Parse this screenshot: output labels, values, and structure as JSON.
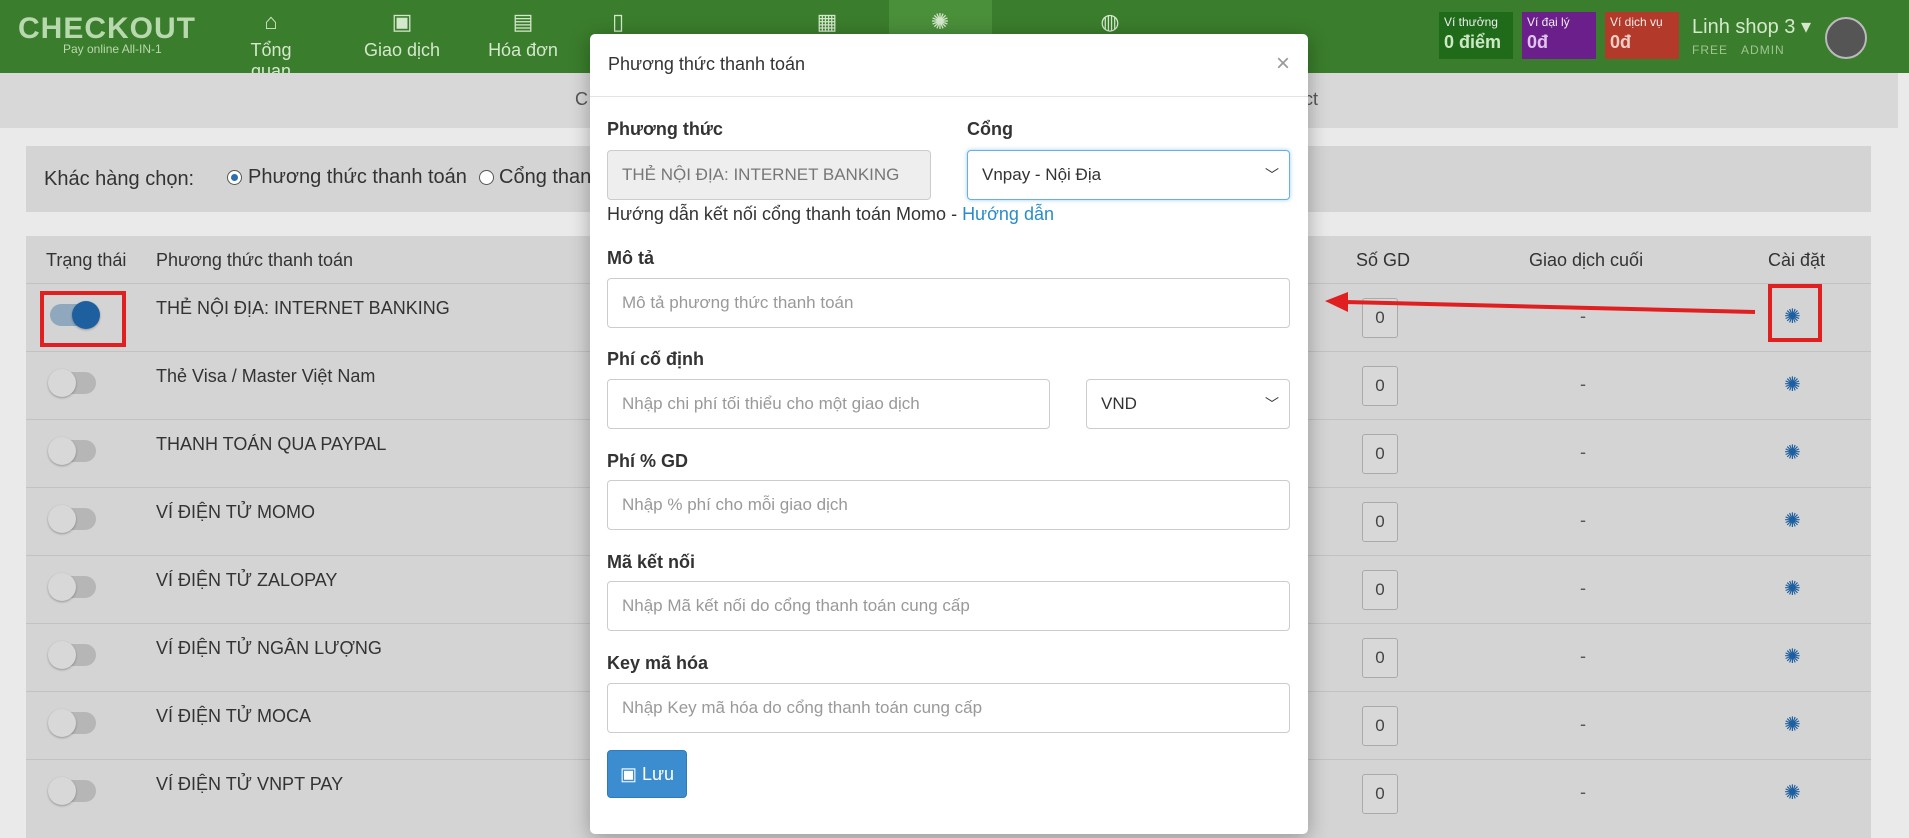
{
  "brand": {
    "logo_text": "CHECKOUT",
    "tagline": "Pay online All-IN-1"
  },
  "nav": {
    "items": [
      {
        "label": "Tổng quan",
        "icon": "home-icon"
      },
      {
        "label": "Giao dịch",
        "icon": "money-icon"
      },
      {
        "label": "Hóa đơn",
        "icon": "document-icon"
      },
      {
        "label": "",
        "icon": "mobile-icon"
      },
      {
        "label": "",
        "icon": "globe-icon"
      },
      {
        "label": "",
        "icon": "calendar-icon"
      },
      {
        "label": "",
        "icon": "gear-icon"
      }
    ]
  },
  "wallets": [
    {
      "label": "Ví thưởng",
      "value": "0 điểm",
      "color": "#1f6b1a"
    },
    {
      "label": "Ví đại lý",
      "value": "0đ",
      "color": "#6b1f8a"
    },
    {
      "label": "Ví dịch vụ",
      "value": "0đ",
      "color": "#b33a2a"
    }
  ],
  "user": {
    "name": "Linh shop 3",
    "plan": "FREE",
    "role": "ADMIN"
  },
  "subbar": {
    "left_fragment": "C",
    "right_fragment": "ct"
  },
  "choice": {
    "label": "Khác hàng chọn:",
    "option1": "Phương thức thanh toán",
    "option2": "Cổng than"
  },
  "table": {
    "headers": {
      "status": "Trạng thái",
      "method": "Phương thức thanh toán",
      "count": "Số GD",
      "last": "Giao dịch cuối",
      "settings": "Cài đặt"
    },
    "rows": [
      {
        "name": "THẺ NỘI ĐỊA: INTERNET BANKING",
        "enabled": true,
        "count": "0",
        "last": "-"
      },
      {
        "name": "Thẻ Visa / Master Việt Nam",
        "enabled": false,
        "count": "0",
        "last": "-"
      },
      {
        "name": "THANH TOÁN QUA PAYPAL",
        "enabled": false,
        "count": "0",
        "last": "-"
      },
      {
        "name": "VÍ ĐIỆN TỬ MOMO",
        "enabled": false,
        "count": "0",
        "last": "-"
      },
      {
        "name": "VÍ ĐIỆN TỬ ZALOPAY",
        "enabled": false,
        "count": "0",
        "last": "-"
      },
      {
        "name": "VÍ ĐIỆN TỬ NGÂN LƯỢNG",
        "enabled": false,
        "count": "0",
        "last": "-"
      },
      {
        "name": "VÍ ĐIỆN TỬ MOCA",
        "enabled": false,
        "count": "0",
        "last": "-"
      },
      {
        "name": "VÍ ĐIỆN TỬ VNPT PAY",
        "enabled": false,
        "count": "0",
        "last": "-"
      }
    ]
  },
  "modal": {
    "title": "Phương thức thanh toán",
    "close": "×",
    "method_label": "Phương thức",
    "method_value": "THẺ NỘI ĐỊA: INTERNET BANKING",
    "gateway_label": "Cổng",
    "gateway_value": "Vnpay - Nội Địa",
    "guide_text": "Hướng dẫn kết nối cổng thanh toán Momo - ",
    "guide_link": "Hướng dẫn",
    "desc_label": "Mô tả",
    "desc_placeholder": "Mô tả phương thức thanh toán",
    "fixed_fee_label": "Phí cố định",
    "fixed_fee_placeholder": "Nhập chi phí tối thiểu cho một giao dịch",
    "currency_value": "VND",
    "pct_fee_label": "Phí % GD",
    "pct_fee_placeholder": "Nhập % phí cho mỗi giao dịch",
    "conn_label": "Mã kết nối",
    "conn_placeholder": "Nhập Mã kết nối do cổng thanh toán cung cấp",
    "key_label": "Key mã hóa",
    "key_placeholder": "Nhập Key mã hóa do cổng thanh toán cung cấp",
    "save_label": "Lưu"
  },
  "colors": {
    "nav_bg": "#3a7d2c",
    "accent": "#1e5fa0",
    "highlight": "#e02020",
    "link": "#2a8cc7"
  }
}
